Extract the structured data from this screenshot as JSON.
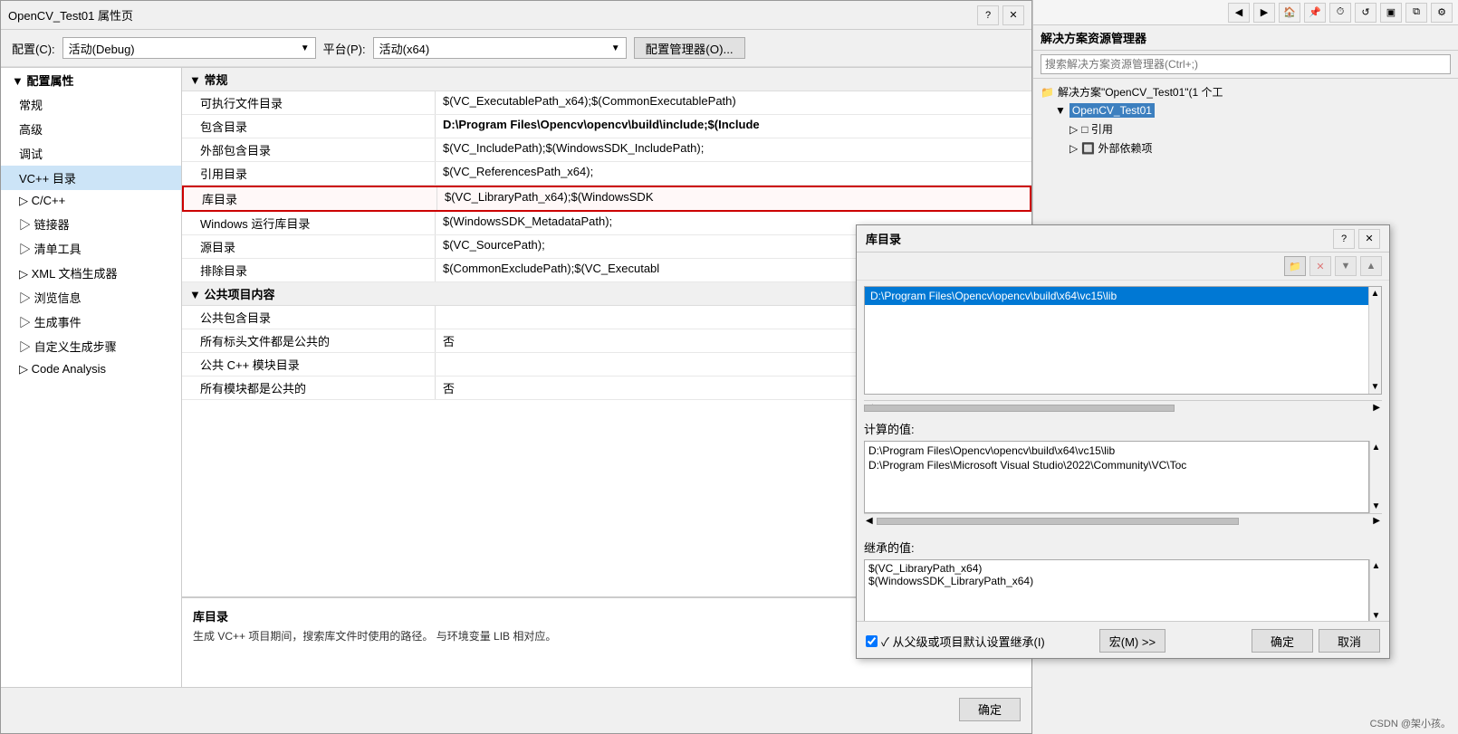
{
  "mainDialog": {
    "title": "OpenCV_Test01 属性页",
    "closeBtn": "✕",
    "helpBtn": "?"
  },
  "configRow": {
    "configLabel": "配置(C):",
    "configValue": "活动(Debug)",
    "platformLabel": "平台(P):",
    "platformValue": "活动(x64)",
    "managerBtn": "配置管理器(O)..."
  },
  "sidebar": {
    "title": "▲ 配置属性",
    "items": [
      {
        "label": "常规",
        "level": "level2"
      },
      {
        "label": "高级",
        "level": "level2"
      },
      {
        "label": "调试",
        "level": "level2"
      },
      {
        "label": "VC++ 目录",
        "level": "level2",
        "active": true
      },
      {
        "label": "▷ C/C++",
        "level": "level2"
      },
      {
        "label": "▷ 链接器",
        "level": "level2"
      },
      {
        "label": "▷ 清单工具",
        "level": "level2"
      },
      {
        "label": "▷ XML 文档生成器",
        "level": "level2"
      },
      {
        "label": "▷ 浏览信息",
        "level": "level2"
      },
      {
        "label": "▷ 生成事件",
        "level": "level2"
      },
      {
        "label": "▷ 自定义生成步骤",
        "level": "level2"
      },
      {
        "label": "▷ Code Analysis",
        "level": "level2"
      }
    ]
  },
  "propsTable": {
    "generalSection": "常规",
    "rows": [
      {
        "name": "可执行文件目录",
        "value": "$(VC_ExecutablePath_x64);$(CommonExecutablePath)"
      },
      {
        "name": "包含目录",
        "value": "D:\\Program Files\\Opencv\\opencv\\build\\include;$(Include",
        "bold": true
      },
      {
        "name": "外部包含目录",
        "value": "$(VC_IncludePath);$(WindowsSDK_IncludePath);"
      },
      {
        "name": "引用目录",
        "value": "$(VC_ReferencesPath_x64);"
      },
      {
        "name": "库目录",
        "value": "$(VC_LibraryPath_x64);$(WindowsSDK",
        "highlight": true
      },
      {
        "name": "Windows 运行库目录",
        "value": "$(WindowsSDK_MetadataPath);"
      },
      {
        "name": "源目录",
        "value": "$(VC_SourcePath);"
      },
      {
        "name": "排除目录",
        "value": "$(CommonExcludePath);$(VC_Executabl"
      }
    ],
    "publicSection": "公共项目内容",
    "publicRows": [
      {
        "name": "公共包含目录",
        "value": ""
      },
      {
        "name": "所有标头文件都是公共的",
        "value": "否"
      },
      {
        "name": "公共 C++ 模块目录",
        "value": ""
      },
      {
        "name": "所有模块都是公共的",
        "value": "否"
      }
    ]
  },
  "description": {
    "title": "库目录",
    "text": "生成 VC++ 项目期间，搜索库文件时使用的路径。 与环境变量 LIB 相对应。"
  },
  "bottomBar": {
    "okBtn": "确定"
  },
  "solutionExplorer": {
    "title": "解决方案资源管理器",
    "searchPlaceholder": "搜索解决方案资源管理器(Ctrl+;)",
    "treeItems": [
      {
        "label": "解决方案\"OpenCV_Test01\"(1 个工",
        "level": 0,
        "icon": "📁"
      },
      {
        "label": "OpenCV_Test01",
        "level": 1,
        "icon": "⬛",
        "bold": true
      },
      {
        "label": "▷ □ 引用",
        "level": 2
      },
      {
        "label": "▷ 🔲 外部依赖项",
        "level": 2
      }
    ]
  },
  "libDialog": {
    "title": "库目录",
    "helpBtn": "?",
    "closeBtn": "✕",
    "listItems": [
      {
        "label": "D:\\Program Files\\Opencv\\opencv\\build\\x64\\vc15\\lib",
        "selected": true
      }
    ],
    "computedLabel": "计算的值:",
    "computedValues": [
      "D:\\Program Files\\Opencv\\opencv\\build\\x64\\vc15\\lib",
      "D:\\Program Files\\Microsoft Visual Studio\\2022\\Community\\VC\\Toc"
    ],
    "inheritedLabel": "继承的值:",
    "inheritedValues": [
      "$(VC_LibraryPath_x64)",
      "$(WindowsSDK_LibraryPath_x64)"
    ],
    "inheritCheckbox": "✓ 从父级或项目默认设置继承(I)",
    "macroBtn": "宏(M) >>",
    "okBtn": "确定",
    "cancelBtn": "取消"
  },
  "watermark": "CSDN @架小孩。"
}
